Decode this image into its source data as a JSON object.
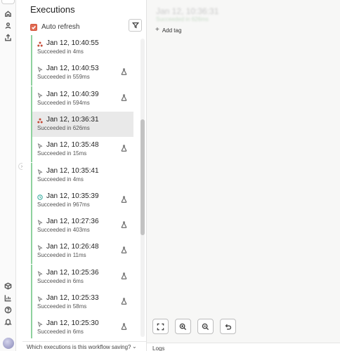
{
  "panel": {
    "title": "Executions",
    "auto_refresh_label": "Auto refresh",
    "auto_refresh_checked": true,
    "filter_icon": "filter-icon"
  },
  "executions": [
    {
      "time": "Jan 12, 10:40:55",
      "status": "Succeeded in 4ms",
      "icon": "nodes-icon",
      "flask": false,
      "selected": false
    },
    {
      "time": "Jan 12, 10:40:53",
      "status": "Succeeded in 559ms",
      "icon": "cursor-icon",
      "flask": true,
      "selected": false
    },
    {
      "time": "Jan 12, 10:40:39",
      "status": "Succeeded in 594ms",
      "icon": "cursor-icon",
      "flask": true,
      "selected": false
    },
    {
      "time": "Jan 12, 10:36:31",
      "status": "Succeeded in 626ms",
      "icon": "nodes-icon",
      "flask": false,
      "selected": true
    },
    {
      "time": "Jan 12, 10:35:48",
      "status": "Succeeded in 15ms",
      "icon": "cursor-icon",
      "flask": true,
      "selected": false
    },
    {
      "time": "Jan 12, 10:35:41",
      "status": "Succeeded in 4ms",
      "icon": "cursor-icon",
      "flask": false,
      "selected": false
    },
    {
      "time": "Jan 12, 10:35:39",
      "status": "Succeeded in 967ms",
      "icon": "clock-icon",
      "flask": true,
      "selected": false
    },
    {
      "time": "Jan 12, 10:27:36",
      "status": "Succeeded in 403ms",
      "icon": "cursor-icon",
      "flask": true,
      "selected": false
    },
    {
      "time": "Jan 12, 10:26:48",
      "status": "Succeeded in 11ms",
      "icon": "cursor-icon",
      "flask": true,
      "selected": false
    },
    {
      "time": "Jan 12, 10:25:36",
      "status": "Succeeded in 6ms",
      "icon": "cursor-icon",
      "flask": true,
      "selected": false
    },
    {
      "time": "Jan 12, 10:25:33",
      "status": "Succeeded in 58ms",
      "icon": "cursor-icon",
      "flask": true,
      "selected": false
    },
    {
      "time": "Jan 12, 10:25:30",
      "status": "Succeeded in 6ms",
      "icon": "cursor-icon",
      "flask": true,
      "selected": false
    }
  ],
  "bottom": {
    "question": "Which executions is this workflow saving?"
  },
  "canvas": {
    "workflow_title": "Jan 12, 10:36:31",
    "workflow_subtitle": "Succeeded in 626ms",
    "add_tag_label": "Add tag",
    "logs_label": "Logs",
    "tools": [
      "fit-view-icon",
      "zoom-in-icon",
      "zoom-out-icon",
      "undo-icon"
    ]
  },
  "rail": {
    "icons": [
      "home-icon",
      "user-icon",
      "share-icon",
      "box-icon",
      "chart-icon",
      "help-icon",
      "bell-icon"
    ]
  },
  "colors": {
    "accent": "#e06b54",
    "success_bar": "#8fd19e",
    "selected_row": "#e9e9e9"
  }
}
